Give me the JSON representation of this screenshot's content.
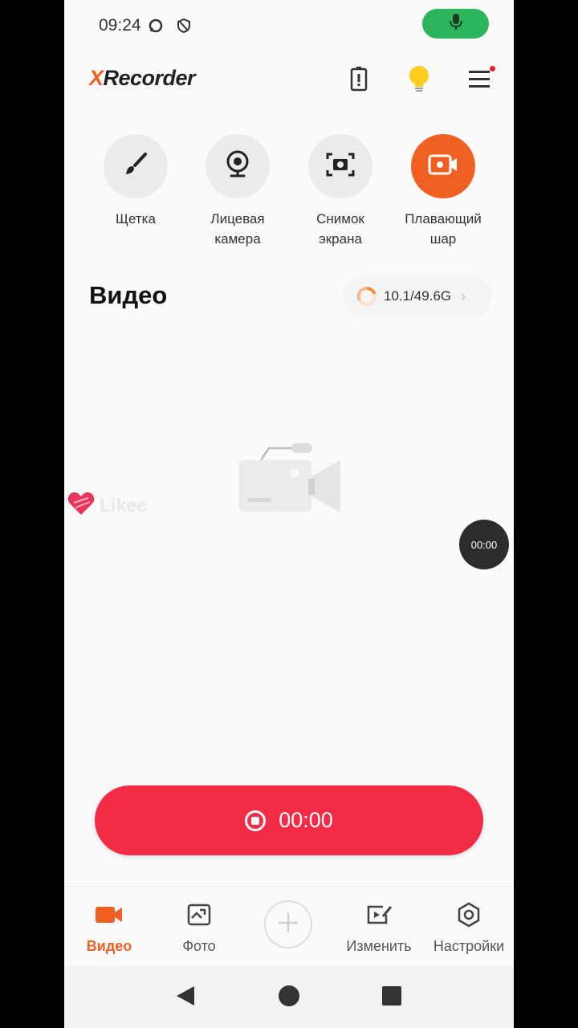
{
  "status_bar": {
    "time": "09:24",
    "icons": [
      "messenger-icon",
      "shield-icon"
    ],
    "mic_indicator_icon": "microphone-icon",
    "mic_color": "#2db55d"
  },
  "app_bar": {
    "logo_x": "X",
    "logo_rest": "Recorder",
    "battery_icon": "battery-alert-icon",
    "tip_icon": "lightbulb-icon",
    "menu_icon": "menu-icon"
  },
  "tools": [
    {
      "label": "Щетка",
      "icon": "brush-icon",
      "active": false
    },
    {
      "label": "Лицевая\nкамера",
      "icon": "webcam-icon",
      "active": false
    },
    {
      "label": "Снимок\nэкрана",
      "icon": "screenshot-icon",
      "active": false
    },
    {
      "label": "Плавающий\nшар",
      "icon": "floating-ball-icon",
      "active": true
    }
  ],
  "section": {
    "title": "Видео",
    "storage_text": "10.1/49.6G",
    "storage_used_fraction": 0.2
  },
  "watermark": {
    "text": "Likee",
    "icon": "heart-icon"
  },
  "floating_timer": "00:00",
  "record_button": {
    "time": "00:00",
    "icon": "stop-icon",
    "color": "#f32b45"
  },
  "bottom_nav": [
    {
      "label": "Видео",
      "icon": "video-camera-icon",
      "active": true
    },
    {
      "label": "Фото",
      "icon": "photo-icon",
      "active": false
    },
    {
      "label": "Изменить",
      "icon": "edit-video-icon",
      "active": false
    },
    {
      "label": "Настройки",
      "icon": "settings-icon",
      "active": false
    }
  ],
  "add_button_icon": "plus-icon",
  "colors": {
    "accent": "#f06022",
    "record": "#f32b45",
    "background": "#fafafa"
  }
}
